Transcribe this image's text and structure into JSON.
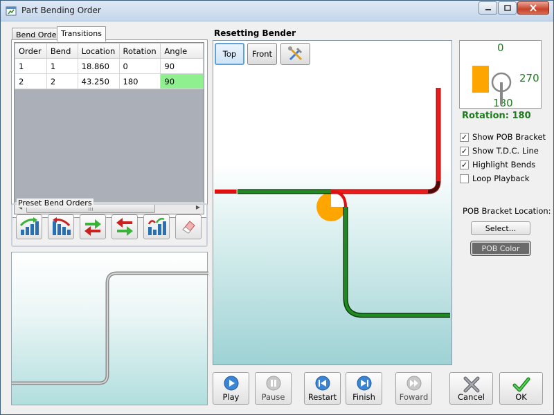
{
  "window": {
    "title": "Part Bending Order"
  },
  "tabs": [
    {
      "label": "Bend Order",
      "active": false
    },
    {
      "label": "Transitions",
      "active": true
    }
  ],
  "grid": {
    "columns": [
      "Order",
      "Bend",
      "Location",
      "Rotation",
      "Angle"
    ],
    "rows": [
      [
        "1",
        "1",
        "18.860",
        "0",
        "90"
      ],
      [
        "2",
        "2",
        "43.250",
        "180",
        "90"
      ]
    ],
    "highlight_color": "#8ff08f"
  },
  "preset": {
    "label": "Preset Bend Orders",
    "buttons": [
      "ascending-bend-icon",
      "descending-bend-icon",
      "swap-green-icon",
      "swap-red-icon",
      "mixed-order-icon",
      "eraser-icon"
    ]
  },
  "viewer": {
    "title": "Resetting Bender",
    "top_label": "Top",
    "front_label": "Front",
    "tools_icon": "tools-icon"
  },
  "rotation": {
    "top": "0",
    "right": "270",
    "bottom": "180",
    "status": "Rotation: 180"
  },
  "options": [
    {
      "label": "Show POB Bracket",
      "checked": true
    },
    {
      "label": "Show T.D.C. Line",
      "checked": true
    },
    {
      "label": "Highlight Bends",
      "checked": true
    },
    {
      "label": "Loop Playback",
      "checked": false
    }
  ],
  "pob": {
    "label": "POB Bracket Location:",
    "select_label": "Select...",
    "color_label": "POB Color"
  },
  "controls": {
    "play": "Play",
    "pause": "Pause",
    "restart": "Restart",
    "finish": "Finish",
    "forward": "Foward",
    "cancel": "Cancel",
    "ok": "OK"
  },
  "colors": {
    "tube_green": "#1a7a1a",
    "tube_red": "#e01010",
    "pob_orange": "#ffa500",
    "status_green": "#1f7a1f"
  }
}
